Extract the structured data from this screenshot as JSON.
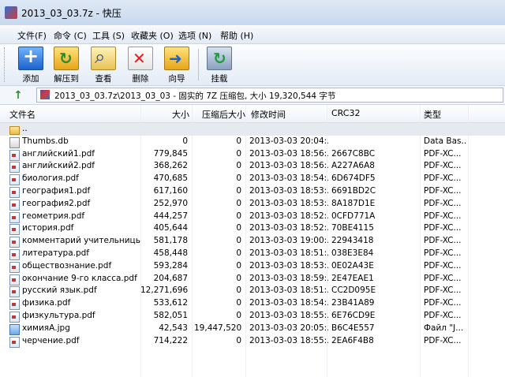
{
  "window": {
    "title": "2013_03_03.7z - 快压"
  },
  "menu": [
    {
      "label": "文件(F)"
    },
    {
      "label": "命令 (C)"
    },
    {
      "label": "工具 (S)"
    },
    {
      "label": "收藏夹 (O)"
    },
    {
      "label": "选项 (N)"
    },
    {
      "label": "帮助 (H)"
    }
  ],
  "toolbar": [
    {
      "label": "添加",
      "icon": "add-icon"
    },
    {
      "label": "解压到",
      "icon": "extract-icon"
    },
    {
      "label": "查看",
      "icon": "view-icon"
    },
    {
      "label": "删除",
      "icon": "delete-icon"
    },
    {
      "label": "向导",
      "icon": "wizard-icon"
    },
    {
      "label": "挂载",
      "icon": "mount-icon"
    }
  ],
  "address": {
    "path": "2013_03_03.7z\\2013_03_03 - 固实的 7Z 压缩包, 大小 19,320,544 字节"
  },
  "columns": {
    "name": "文件名",
    "size": "大小",
    "packed": "压缩后大小",
    "modified": "修改时间",
    "crc": "CRC32",
    "type": "类型"
  },
  "files": [
    {
      "name": "..",
      "size": "",
      "packed": "",
      "modified": "",
      "crc": "",
      "type": "",
      "icon": "folder"
    },
    {
      "name": "Thumbs.db",
      "size": "0",
      "packed": "0",
      "modified": "2013-03-03 20:04:...",
      "crc": "",
      "type": "Data Bas...",
      "icon": "db"
    },
    {
      "name": "английский1.pdf",
      "size": "779,845",
      "packed": "0",
      "modified": "2013-03-03 18:56:...",
      "crc": "2667C8BC",
      "type": "PDF-XC...",
      "icon": "pdf"
    },
    {
      "name": "английский2.pdf",
      "size": "368,262",
      "packed": "0",
      "modified": "2013-03-03 18:56:...",
      "crc": "A227A6A8",
      "type": "PDF-XC...",
      "icon": "pdf"
    },
    {
      "name": "биология.pdf",
      "size": "470,685",
      "packed": "0",
      "modified": "2013-03-03 18:54:...",
      "crc": "6D674DF5",
      "type": "PDF-XC...",
      "icon": "pdf"
    },
    {
      "name": "география1.pdf",
      "size": "617,160",
      "packed": "0",
      "modified": "2013-03-03 18:53:...",
      "crc": "6691BD2C",
      "type": "PDF-XC...",
      "icon": "pdf"
    },
    {
      "name": "география2.pdf",
      "size": "252,970",
      "packed": "0",
      "modified": "2013-03-03 18:53:...",
      "crc": "8A187D1E",
      "type": "PDF-XC...",
      "icon": "pdf"
    },
    {
      "name": "геометрия.pdf",
      "size": "444,257",
      "packed": "0",
      "modified": "2013-03-03 18:52:...",
      "crc": "0CFD771A",
      "type": "PDF-XC...",
      "icon": "pdf"
    },
    {
      "name": "история.pdf",
      "size": "405,644",
      "packed": "0",
      "modified": "2013-03-03 18:52:...",
      "crc": "70BE4115",
      "type": "PDF-XC...",
      "icon": "pdf"
    },
    {
      "name": "комментарий учительницы о...",
      "size": "581,178",
      "packed": "0",
      "modified": "2013-03-03 19:00:...",
      "crc": "22943418",
      "type": "PDF-XC...",
      "icon": "pdf"
    },
    {
      "name": "литература.pdf",
      "size": "458,448",
      "packed": "0",
      "modified": "2013-03-03 18:51:...",
      "crc": "038E3E84",
      "type": "PDF-XC...",
      "icon": "pdf"
    },
    {
      "name": "обществознание.pdf",
      "size": "593,284",
      "packed": "0",
      "modified": "2013-03-03 18:53:...",
      "crc": "0E02A43E",
      "type": "PDF-XC...",
      "icon": "pdf"
    },
    {
      "name": "окончание 9-го класса.pdf",
      "size": "204,687",
      "packed": "0",
      "modified": "2013-03-03 18:59:...",
      "crc": "2E47EAE1",
      "type": "PDF-XC...",
      "icon": "pdf"
    },
    {
      "name": "русский язык.pdf",
      "size": "12,271,696",
      "packed": "0",
      "modified": "2013-03-03 18:51:...",
      "crc": "CC2D095E",
      "type": "PDF-XC...",
      "icon": "pdf"
    },
    {
      "name": "физика.pdf",
      "size": "533,612",
      "packed": "0",
      "modified": "2013-03-03 18:54:...",
      "crc": "23B41A89",
      "type": "PDF-XC...",
      "icon": "pdf"
    },
    {
      "name": "физкультура.pdf",
      "size": "582,051",
      "packed": "0",
      "modified": "2013-03-03 18:55:...",
      "crc": "6E76CD9E",
      "type": "PDF-XC...",
      "icon": "pdf"
    },
    {
      "name": "химияА.jpg",
      "size": "42,543",
      "packed": "19,447,520",
      "modified": "2013-03-03 20:05:...",
      "crc": "B6C4E557",
      "type": "Файл \"J...",
      "icon": "jpg"
    },
    {
      "name": "черчение.pdf",
      "size": "714,222",
      "packed": "0",
      "modified": "2013-03-03 18:55:...",
      "crc": "2EA6F4B8",
      "type": "PDF-XC...",
      "icon": "pdf"
    }
  ]
}
